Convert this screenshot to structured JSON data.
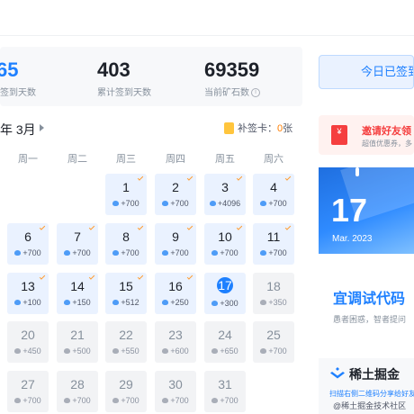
{
  "stats": [
    {
      "value": "65",
      "label": "续签到天数"
    },
    {
      "value": "403",
      "label": "累计签到天数"
    },
    {
      "value": "69359",
      "label": "当前矿石数"
    }
  ],
  "calendar": {
    "month_label": "年 3月",
    "patch_label": "补签卡：",
    "patch_count": "0",
    "patch_unit": "张",
    "weekdays": [
      "周一",
      "周二",
      "周三",
      "周四",
      "周五",
      "周六"
    ],
    "days": [
      {
        "day": "1",
        "reward": "+700",
        "status": "signed",
        "col": 2,
        "row": 0
      },
      {
        "day": "2",
        "reward": "+700",
        "status": "signed",
        "col": 3,
        "row": 0
      },
      {
        "day": "3",
        "reward": "+4096",
        "status": "signed",
        "col": 4,
        "row": 0
      },
      {
        "day": "4",
        "reward": "+700",
        "status": "signed",
        "col": 5,
        "row": 0
      },
      {
        "day": "6",
        "reward": "+700",
        "status": "signed",
        "col": 0,
        "row": 1
      },
      {
        "day": "7",
        "reward": "+700",
        "status": "signed",
        "col": 1,
        "row": 1
      },
      {
        "day": "8",
        "reward": "+700",
        "status": "signed",
        "col": 2,
        "row": 1
      },
      {
        "day": "9",
        "reward": "+700",
        "status": "signed",
        "col": 3,
        "row": 1
      },
      {
        "day": "10",
        "reward": "+700",
        "status": "signed",
        "col": 4,
        "row": 1
      },
      {
        "day": "11",
        "reward": "+700",
        "status": "signed",
        "col": 5,
        "row": 1
      },
      {
        "day": "13",
        "reward": "+100",
        "status": "signed",
        "col": 0,
        "row": 2
      },
      {
        "day": "14",
        "reward": "+150",
        "status": "signed",
        "col": 1,
        "row": 2
      },
      {
        "day": "15",
        "reward": "+512",
        "status": "signed",
        "col": 2,
        "row": 2
      },
      {
        "day": "16",
        "reward": "+250",
        "status": "signed",
        "col": 3,
        "row": 2
      },
      {
        "day": "17",
        "reward": "+300",
        "status": "today",
        "col": 4,
        "row": 2
      },
      {
        "day": "18",
        "reward": "+350",
        "status": "future",
        "col": 5,
        "row": 2
      },
      {
        "day": "20",
        "reward": "+450",
        "status": "future",
        "col": 0,
        "row": 3
      },
      {
        "day": "21",
        "reward": "+500",
        "status": "future",
        "col": 1,
        "row": 3
      },
      {
        "day": "22",
        "reward": "+550",
        "status": "future",
        "col": 2,
        "row": 3
      },
      {
        "day": "23",
        "reward": "+600",
        "status": "future",
        "col": 3,
        "row": 3
      },
      {
        "day": "24",
        "reward": "+650",
        "status": "future",
        "col": 4,
        "row": 3
      },
      {
        "day": "25",
        "reward": "+700",
        "status": "future",
        "col": 5,
        "row": 3
      },
      {
        "day": "27",
        "reward": "+700",
        "status": "future",
        "col": 0,
        "row": 4
      },
      {
        "day": "28",
        "reward": "+700",
        "status": "future",
        "col": 1,
        "row": 4
      },
      {
        "day": "29",
        "reward": "+700",
        "status": "future",
        "col": 2,
        "row": 4
      },
      {
        "day": "30",
        "reward": "+700",
        "status": "future",
        "col": 3,
        "row": 4
      },
      {
        "day": "31",
        "reward": "+700",
        "status": "future",
        "col": 4,
        "row": 4
      }
    ]
  },
  "sidebar": {
    "signed_button": "今日已签到",
    "invite_icon_char": "¥",
    "invite_title": "邀请好友领",
    "invite_sub": "超值优惠券，多",
    "big_day": "17",
    "big_month": "Mar. 2023",
    "fortune_title": "宜调试代码",
    "fortune_sub": "愚者困惑，智者提问",
    "brand_name": "稀土掘金",
    "brand_sub": "扫描右侧二维码分享给好友",
    "watermark": "@稀土掘金技术社区"
  },
  "colors": {
    "accent": "#1e80ff",
    "danger": "#f53f3f",
    "warning": "#ff7d00"
  }
}
